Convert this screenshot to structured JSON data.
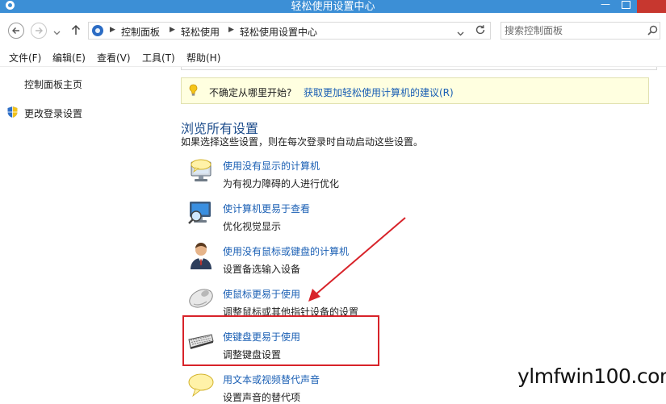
{
  "window": {
    "title": "轻松使用设置中心"
  },
  "address": {
    "breadcrumbs": [
      "控制面板",
      "轻松使用",
      "轻松使用设置中心"
    ]
  },
  "search": {
    "placeholder": "搜索控制面板"
  },
  "menu": [
    "文件(F)",
    "编辑(E)",
    "查看(V)",
    "工具(T)",
    "帮助(H)"
  ],
  "sidebar": {
    "home": "控制面板主页",
    "login": "更改登录设置"
  },
  "tip": {
    "static": "不确定从哪里开始?",
    "link": "获取更加轻松使用计算机的建议(R)"
  },
  "section": {
    "title": "浏览所有设置",
    "description": "如果选择这些设置，则在每次登录时自动启动这些设置。"
  },
  "items": [
    {
      "title": "使用没有显示的计算机",
      "desc": "为有视力障碍的人进行优化",
      "icon": "speech-monitor-icon"
    },
    {
      "title": "使计算机更易于查看",
      "desc": "优化视觉显示",
      "icon": "magnifier-monitor-icon"
    },
    {
      "title": "使用没有鼠标或键盘的计算机",
      "desc": "设置备选输入设备",
      "icon": "person-icon"
    },
    {
      "title": "使鼠标更易于使用",
      "desc": "调整鼠标或其他指针设备的设置",
      "icon": "mouse-icon"
    },
    {
      "title": "使键盘更易于使用",
      "desc": "调整键盘设置",
      "icon": "keyboard-icon"
    },
    {
      "title": "用文本或视频替代声音",
      "desc": "设置声音的替代项",
      "icon": "speech-bubble-icon"
    }
  ],
  "watermark": "ylmfwin100.com",
  "colors": {
    "titlebar": "#3c8fd6",
    "link": "#1a5fb4",
    "highlight": "#d8232a"
  }
}
